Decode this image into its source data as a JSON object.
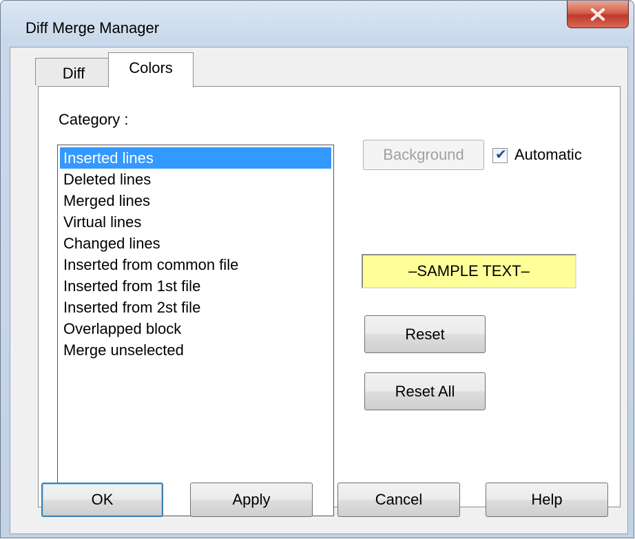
{
  "window": {
    "title": "Diff Merge Manager",
    "close_icon": "close-icon"
  },
  "tabs": [
    {
      "label": "Diff",
      "active": false
    },
    {
      "label": "Colors",
      "active": true
    }
  ],
  "category": {
    "label": "Category :",
    "items": [
      "Inserted lines",
      "Deleted lines",
      "Merged lines",
      "Virtual lines",
      "Changed lines",
      "Inserted from common file",
      "Inserted from 1st file",
      "Inserted from 2st file",
      "Overlapped block",
      "Merge unselected"
    ],
    "selected": "Inserted lines"
  },
  "color_controls": {
    "background_label": "Background",
    "background_enabled": false,
    "automatic_label": "Automatic",
    "automatic_checked": true,
    "sample_text": "–SAMPLE TEXT–",
    "sample_bg": "#ffff99",
    "reset_label": "Reset",
    "reset_all_label": "Reset All"
  },
  "footer": {
    "ok_label": "OK",
    "apply_label": "Apply",
    "cancel_label": "Cancel",
    "help_label": "Help"
  },
  "colors": {
    "selection": "#3399ff",
    "close_button": "#c0392b"
  }
}
